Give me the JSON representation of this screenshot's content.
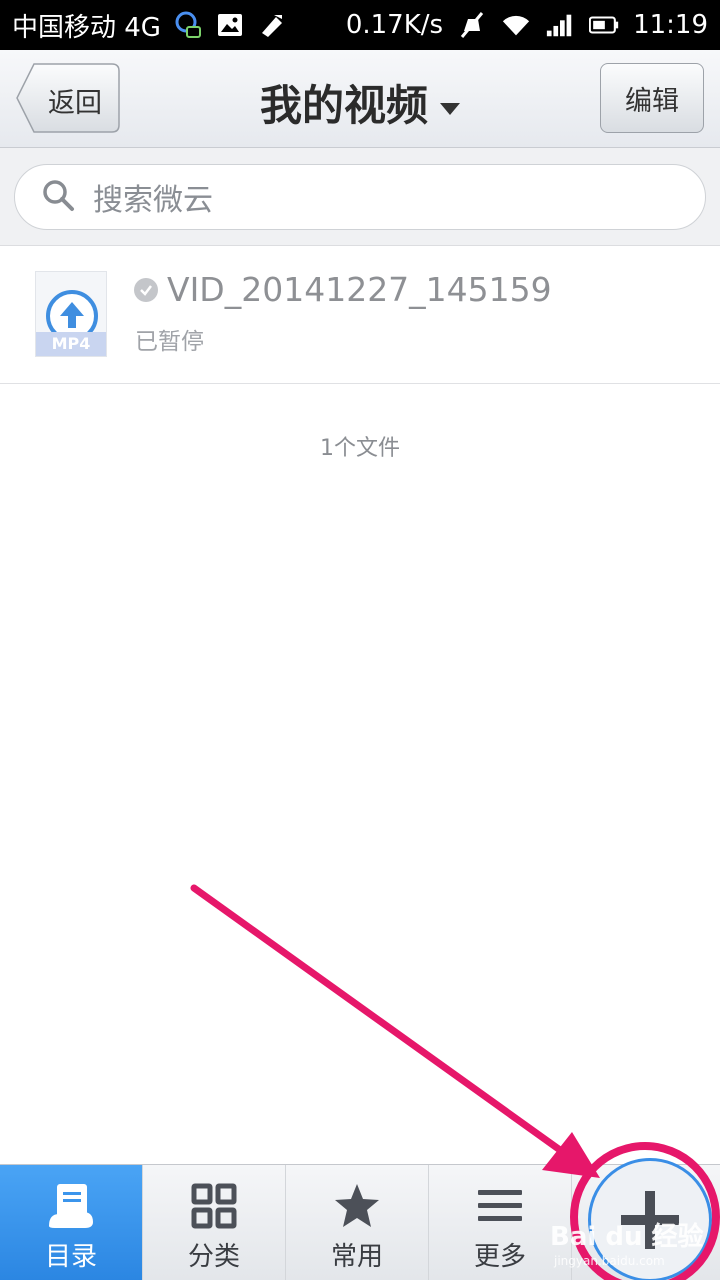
{
  "status_bar": {
    "carrier": "中国移动 4G",
    "speed": "0.17K/s",
    "time": "11:19"
  },
  "header": {
    "back_label": "返回",
    "title": "我的视频",
    "edit_label": "编辑"
  },
  "search": {
    "placeholder": "搜索微云"
  },
  "files": [
    {
      "name": "VID_20141227_145159",
      "status": "已暂停",
      "ext": "MP4"
    }
  ],
  "file_count": "1个文件",
  "bottom_nav": {
    "items": [
      {
        "label": "目录",
        "icon": "directory-icon",
        "active": true
      },
      {
        "label": "分类",
        "icon": "grid-icon",
        "active": false
      },
      {
        "label": "常用",
        "icon": "star-icon",
        "active": false
      },
      {
        "label": "更多",
        "icon": "menu-icon",
        "active": false
      }
    ],
    "add_icon": "plus-icon"
  },
  "watermark": {
    "brand": "Bai du 经验",
    "url": "jingyan.baidu.com"
  },
  "colors": {
    "accent_blue": "#2b86e2",
    "annotation_pink": "#e6176a"
  }
}
